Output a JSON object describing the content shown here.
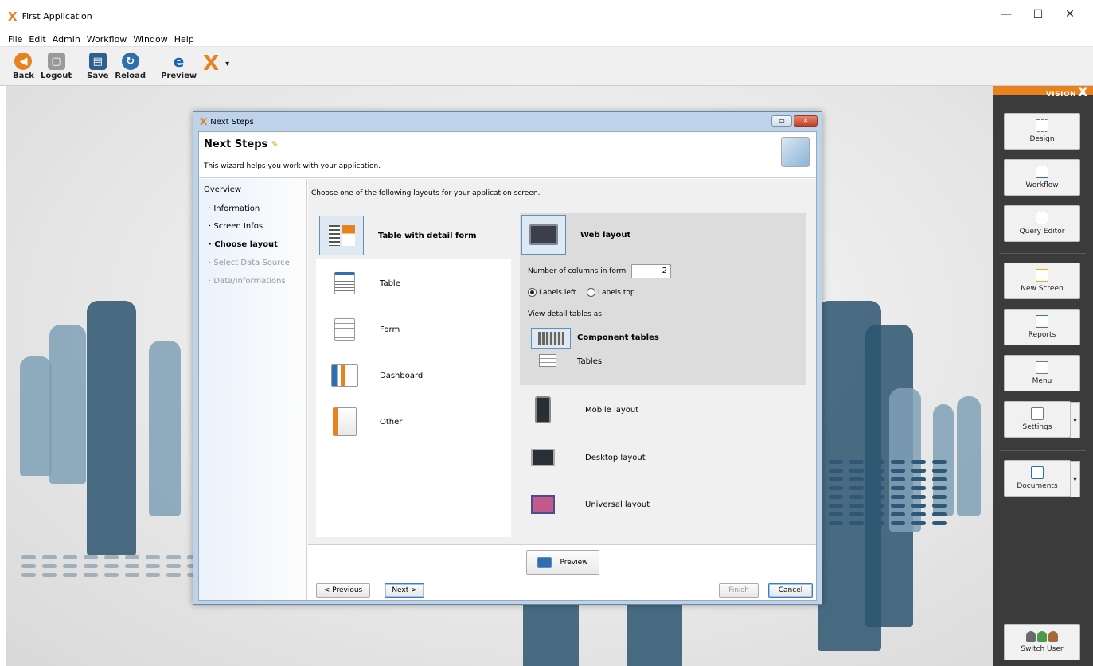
{
  "window": {
    "title": "First Application",
    "controls": {
      "minimize": "—",
      "maximize": "☐",
      "close": "✕"
    }
  },
  "menu": [
    "File",
    "Edit",
    "Admin",
    "Workflow",
    "Window",
    "Help"
  ],
  "toolbar": {
    "back": "Back",
    "logout": "Logout",
    "save": "Save",
    "reload": "Reload",
    "preview": "Preview"
  },
  "sidepanel": {
    "logo_text": "VISION",
    "logo_mark": "X",
    "buttons": {
      "design": "Design",
      "workflow": "Workflow",
      "query_editor": "Query Editor",
      "new_screen": "New Screen",
      "reports": "Reports",
      "menu": "Menu",
      "settings": "Settings",
      "documents": "Documents",
      "switch_user": "Switch User"
    }
  },
  "dialog": {
    "title": "Next Steps",
    "header_title": "Next Steps",
    "header_subtitle": "This wizard helps you work with your application.",
    "nav": {
      "heading": "Overview",
      "items": [
        {
          "label": "Information"
        },
        {
          "label": "Screen Infos"
        },
        {
          "label": "Choose layout"
        },
        {
          "label": "Select Data Source"
        },
        {
          "label": "Data/Informations"
        }
      ]
    },
    "hint": "Choose one of the following layouts for your application screen.",
    "layouts": [
      {
        "label": "Table with detail form"
      },
      {
        "label": "Table"
      },
      {
        "label": "Form"
      },
      {
        "label": "Dashboard"
      },
      {
        "label": "Other"
      }
    ],
    "web_layout": {
      "label": "Web layout",
      "columns_label": "Number of columns in form",
      "columns_value": "2",
      "labels_left": "Labels left",
      "labels_top": "Labels top",
      "view_detail_label": "View detail tables as",
      "component_tables": "Component tables",
      "tables": "Tables"
    },
    "other_layouts": {
      "mobile": "Mobile layout",
      "desktop": "Desktop layout",
      "universal": "Universal layout"
    },
    "buttons": {
      "preview": "Preview",
      "previous": "< Previous",
      "next": "Next >",
      "finish": "Finish",
      "cancel": "Cancel"
    }
  },
  "colors": {
    "accent": "#e8821e",
    "sidepanel_bg": "#3b3b3b",
    "silhouette_dark": "#2d5570",
    "silhouette_light": "#7fa0b6",
    "selection_border": "#5d8fbf"
  }
}
